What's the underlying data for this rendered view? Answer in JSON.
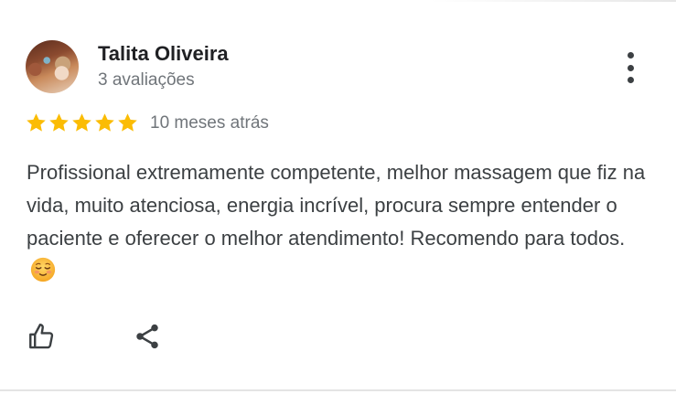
{
  "review": {
    "reviewer_name": "Talita Oliveira",
    "reviewer_meta": "3 avaliações",
    "rating": 5,
    "rating_max": 5,
    "date": "10 meses atrás",
    "text": "Profissional extremamente competente, melhor massagem que fiz na vida, muito atenciosa, energia incrível, procura sempre entender o paciente e oferecer o melhor atendimento! Recomendo para todos.",
    "emoji": "smiling-face-emoji"
  },
  "actions": {
    "like_icon": "thumbs-up-icon",
    "share_icon": "share-icon",
    "more_icon": "more-vert-icon"
  },
  "colors": {
    "star": "#fbbc04",
    "name": "#202124",
    "meta": "#70757a",
    "body": "#3c4043",
    "icon": "#3c4043"
  }
}
